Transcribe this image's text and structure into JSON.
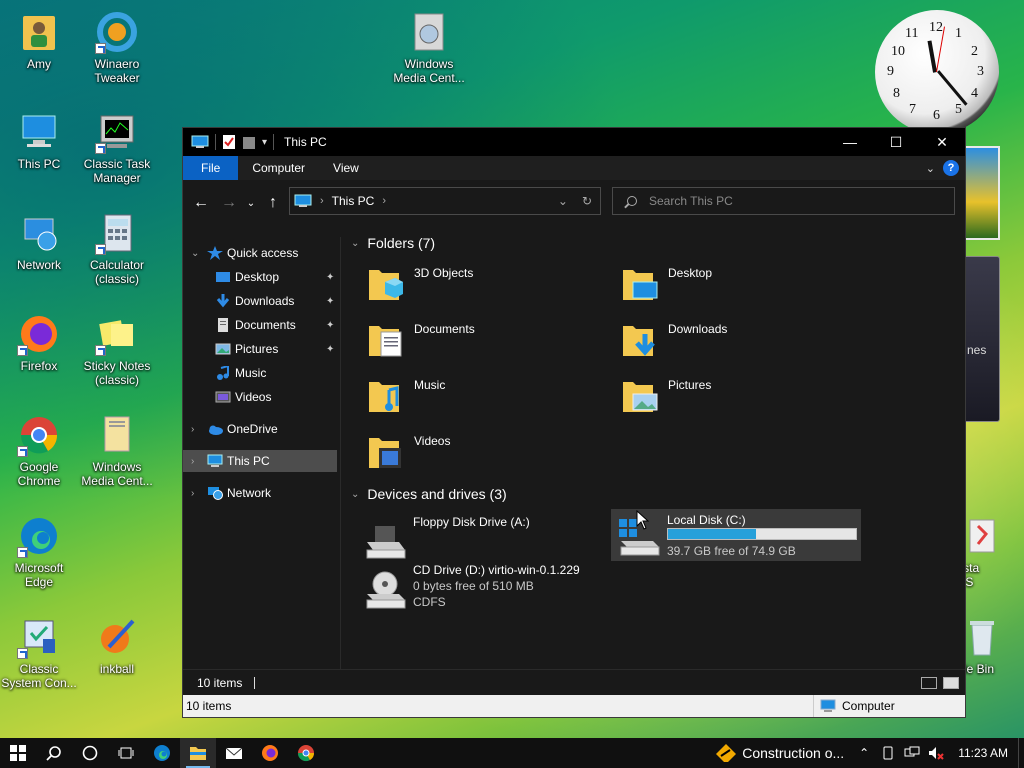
{
  "desktop": {
    "icons": [
      {
        "id": "amy",
        "label": "Amy"
      },
      {
        "id": "winaero",
        "label": "Winaero\nTweaker"
      },
      {
        "id": "wmc-top",
        "label": "Windows\nMedia Cent..."
      },
      {
        "id": "this-pc",
        "label": "This PC"
      },
      {
        "id": "task-manager",
        "label": "Classic Task\nManager"
      },
      {
        "id": "network",
        "label": "Network"
      },
      {
        "id": "calculator",
        "label": "Calculator\n(classic)"
      },
      {
        "id": "firefox",
        "label": "Firefox"
      },
      {
        "id": "sticky-notes",
        "label": "Sticky Notes\n(classic)"
      },
      {
        "id": "chrome",
        "label": "Google\nChrome"
      },
      {
        "id": "wmc-left",
        "label": "Windows\nMedia Cent..."
      },
      {
        "id": "edge",
        "label": "Microsoft\nEdge"
      },
      {
        "id": "classic-system",
        "label": "Classic\nSystem Con..."
      },
      {
        "id": "inkball",
        "label": "inkball"
      },
      {
        "id": "vista-right",
        "label": "nVista\nn-US"
      },
      {
        "id": "recycle-bin",
        "label": "cycle Bin"
      }
    ],
    "gadget_text": "nes",
    "clock_numbers": [
      "12",
      "1",
      "2",
      "3",
      "4",
      "5",
      "6",
      "7",
      "8",
      "9",
      "10",
      "11"
    ]
  },
  "window": {
    "title": "This PC",
    "controls": {
      "minimize": "—",
      "maximize": "☐",
      "close": "✕"
    },
    "ribbon_tabs": [
      "File",
      "Computer",
      "View"
    ],
    "address": {
      "crumb": "This PC"
    },
    "search": {
      "placeholder": "Search This PC"
    },
    "nav_pane": {
      "quick_access": "Quick access",
      "items": [
        {
          "label": "Desktop",
          "pinned": true
        },
        {
          "label": "Downloads",
          "pinned": true
        },
        {
          "label": "Documents",
          "pinned": true
        },
        {
          "label": "Pictures",
          "pinned": true
        },
        {
          "label": "Music",
          "pinned": false
        },
        {
          "label": "Videos",
          "pinned": false
        }
      ],
      "onedrive": "OneDrive",
      "this_pc": "This PC",
      "network": "Network"
    },
    "folders_header": "Folders (7)",
    "folders": [
      "3D Objects",
      "Desktop",
      "Documents",
      "Downloads",
      "Music",
      "Pictures",
      "Videos"
    ],
    "drives_header": "Devices and drives (3)",
    "drives": [
      {
        "name": "Floppy Disk Drive (A:)"
      },
      {
        "name": "Local Disk (C:)",
        "free_text": "39.7 GB free of 74.9 GB",
        "used_fraction": 0.47
      },
      {
        "name": "CD Drive (D:) virtio-win-0.1.229",
        "free_text": "0 bytes free of 510 MB",
        "fs": "CDFS"
      }
    ],
    "status_count": "10 items",
    "details_left": "10 items",
    "details_right": "Computer"
  },
  "taskbar": {
    "notification": "Construction o...",
    "time": "11:23 AM"
  },
  "colors": {
    "accent": "#0b62c4",
    "progress": "#26a0da",
    "folder": "#f3c850"
  }
}
